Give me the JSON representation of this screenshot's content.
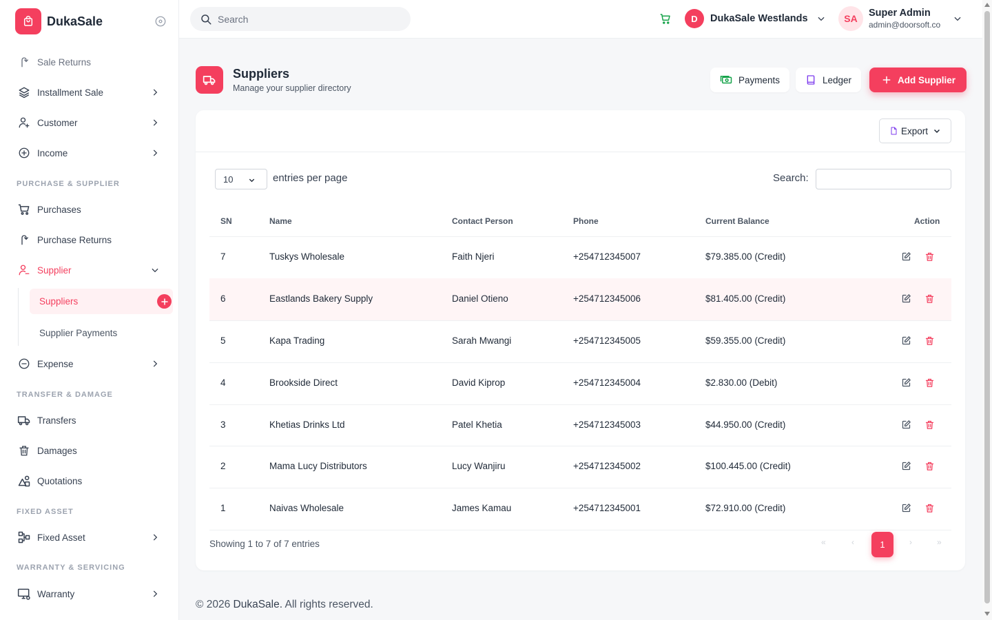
{
  "app": {
    "name": "DukaSale"
  },
  "sidebar": {
    "items": [
      {
        "label": "Sale Returns"
      },
      {
        "label": "Installment Sale"
      },
      {
        "label": "Customer"
      },
      {
        "label": "Income"
      }
    ],
    "sections": {
      "purchase": "PURCHASE & SUPPLIER",
      "transfer": "TRANSFER & DAMAGE",
      "fixed": "FIXED ASSET",
      "warranty": "WARRANTY & SERVICING"
    },
    "purchase_items": [
      {
        "label": "Purchases"
      },
      {
        "label": "Purchase Returns"
      },
      {
        "label": "Supplier"
      }
    ],
    "supplier_sub": [
      {
        "label": "Suppliers"
      },
      {
        "label": "Supplier Payments"
      }
    ],
    "expense": "Expense",
    "transfer_items": [
      {
        "label": "Transfers"
      },
      {
        "label": "Damages"
      },
      {
        "label": "Quotations"
      }
    ],
    "fixed_asset": "Fixed Asset",
    "warranty": "Warranty"
  },
  "topbar": {
    "search_placeholder": "Search",
    "store_initial": "D",
    "store_name": "DukaSale Westlands",
    "user_initials": "SA",
    "user_name": "Super Admin",
    "user_email": "admin@doorsoft.co"
  },
  "page": {
    "title": "Suppliers",
    "subtitle": "Manage your supplier directory",
    "payments_btn": "Payments",
    "ledger_btn": "Ledger",
    "add_btn": "Add Supplier"
  },
  "table": {
    "export_label": "Export",
    "entries_value": "10",
    "entries_label": "entries per page",
    "search_label": "Search:",
    "columns": {
      "sn": "SN",
      "name": "Name",
      "contact": "Contact Person",
      "phone": "Phone",
      "balance": "Current Balance",
      "action": "Action"
    },
    "rows": [
      {
        "sn": "7",
        "name": "Tuskys Wholesale",
        "contact": "Faith Njeri",
        "phone": "+254712345007",
        "balance": "$79.385.00 (Credit)"
      },
      {
        "sn": "6",
        "name": "Eastlands Bakery Supply",
        "contact": "Daniel Otieno",
        "phone": "+254712345006",
        "balance": "$81.405.00 (Credit)"
      },
      {
        "sn": "5",
        "name": "Kapa Trading",
        "contact": "Sarah Mwangi",
        "phone": "+254712345005",
        "balance": "$59.355.00 (Credit)"
      },
      {
        "sn": "4",
        "name": "Brookside Direct",
        "contact": "David Kiprop",
        "phone": "+254712345004",
        "balance": "$2.830.00 (Debit)"
      },
      {
        "sn": "3",
        "name": "Khetias Drinks Ltd",
        "contact": "Patel Khetia",
        "phone": "+254712345003",
        "balance": "$44.950.00 (Credit)"
      },
      {
        "sn": "2",
        "name": "Mama Lucy Distributors",
        "contact": "Lucy Wanjiru",
        "phone": "+254712345002",
        "balance": "$100.445.00 (Credit)"
      },
      {
        "sn": "1",
        "name": "Naivas Wholesale",
        "contact": "James Kamau",
        "phone": "+254712345001",
        "balance": "$72.910.00 (Credit)"
      }
    ],
    "showing": "Showing 1 to 7 of 7 entries",
    "pagination": {
      "first": "«",
      "prev": "‹",
      "current": "1",
      "next": "›",
      "last": "»"
    }
  },
  "footer": {
    "year": "© 2026",
    "brand": "DukaSale.",
    "rights": "All rights reserved."
  },
  "colors": {
    "accent": "#f43f5e",
    "success": "#16a34a",
    "purple": "#7c3aed"
  }
}
